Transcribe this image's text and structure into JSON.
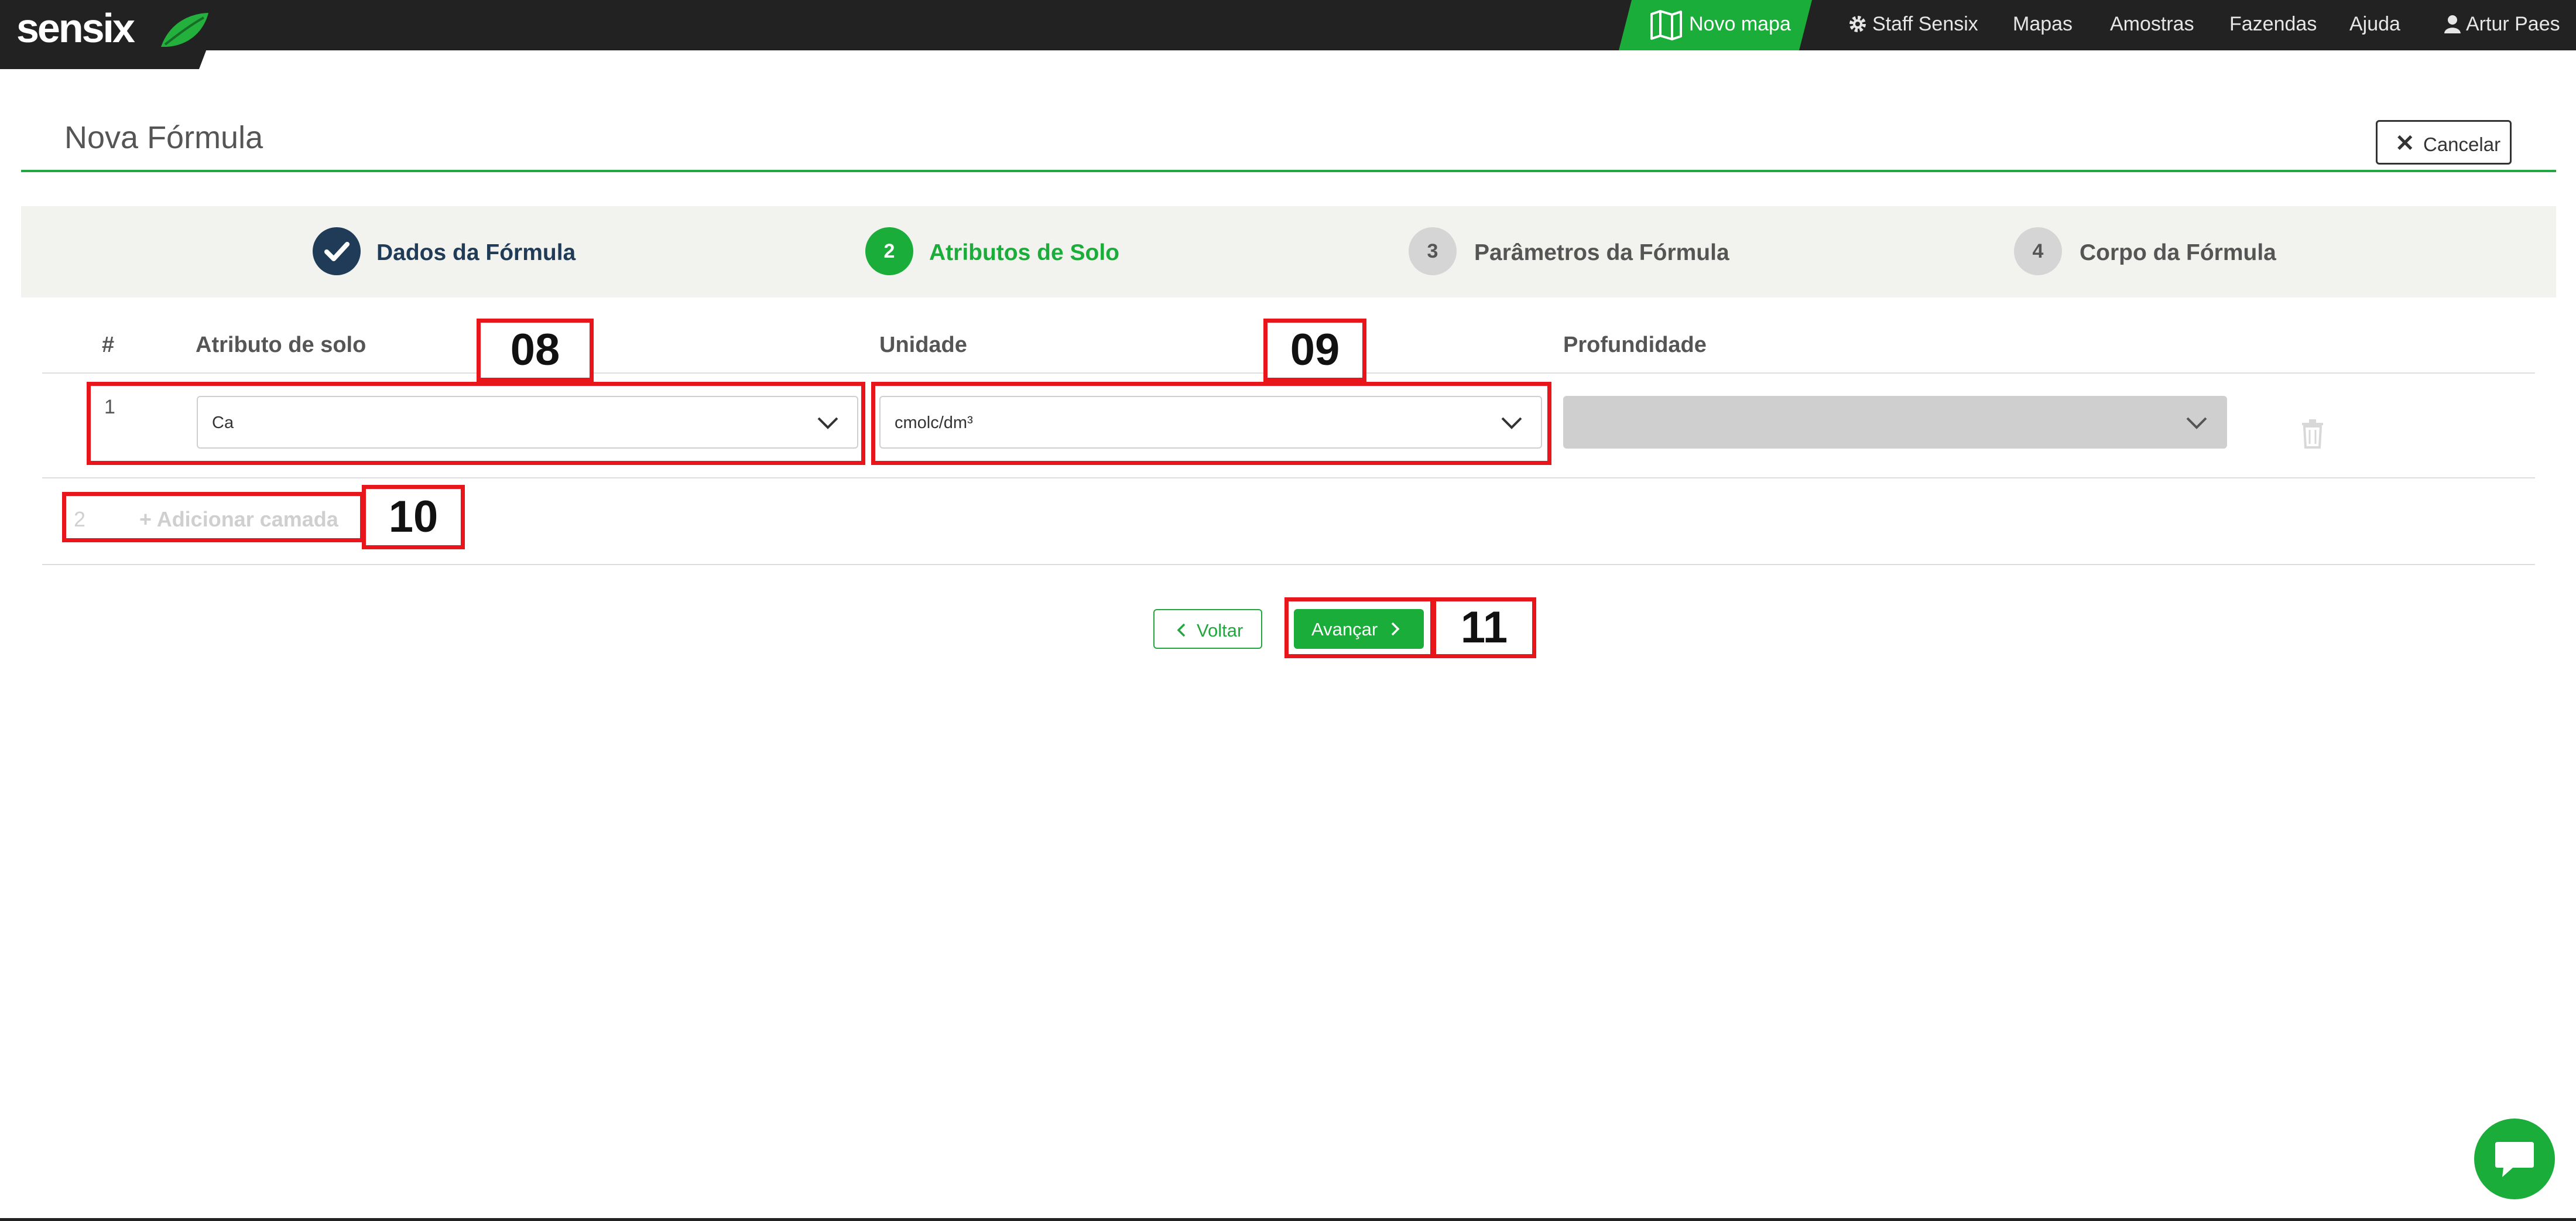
{
  "brand": {
    "logo_text": "sensix"
  },
  "nav": {
    "new_map": "Novo mapa",
    "items": [
      "Staff Sensix",
      "Mapas",
      "Amostras",
      "Fazendas",
      "Ajuda",
      "Artur Paes"
    ]
  },
  "page": {
    "title": "Nova Fórmula",
    "cancel_label": "Cancelar"
  },
  "stepper": {
    "steps": [
      {
        "number": "",
        "label": "Dados da Fórmula",
        "state": "done"
      },
      {
        "number": "2",
        "label": "Atributos de Solo",
        "state": "active"
      },
      {
        "number": "3",
        "label": "Parâmetros da Fórmula",
        "state": "pending"
      },
      {
        "number": "4",
        "label": "Corpo da Fórmula",
        "state": "pending"
      }
    ]
  },
  "table": {
    "headers": {
      "index": "#",
      "attribute": "Atributo de solo",
      "unit": "Unidade",
      "depth": "Profundidade"
    },
    "rows": [
      {
        "index": "1",
        "attribute": "Ca",
        "unit": "cmolc/dm³",
        "depth": ""
      }
    ],
    "add_row": {
      "index": "2",
      "label": "+ Adicionar camada"
    }
  },
  "buttons": {
    "back": "Voltar",
    "next": "Avançar"
  },
  "annotations": [
    "08",
    "09",
    "10",
    "11"
  ],
  "colors": {
    "brand_green": "#1aad3a",
    "nav_bg": "#222222",
    "annotation_red": "#e8151b",
    "step_done": "#1f3b57"
  },
  "icons": [
    "map-icon",
    "gear-icon",
    "user-icon",
    "close-icon",
    "check-icon",
    "chevron-down-icon",
    "trash-icon",
    "chevron-left-icon",
    "chevron-right-icon",
    "chat-icon"
  ]
}
